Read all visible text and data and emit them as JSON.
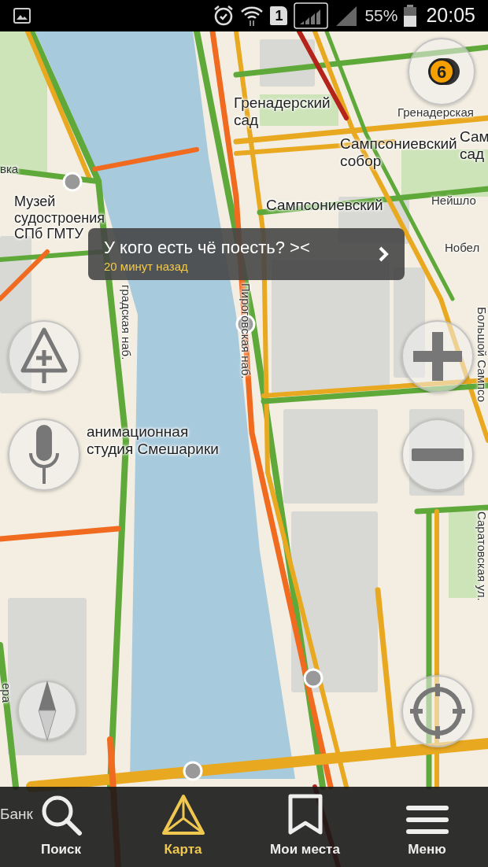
{
  "status_bar": {
    "sim": "1",
    "battery_text": "55%",
    "time": "20:05"
  },
  "map": {
    "labels": [
      {
        "text": "Гренадерский сад",
        "kind": "place"
      },
      {
        "text": "Гренадерская",
        "kind": "street"
      },
      {
        "text": "Сампсониевский собор",
        "kind": "place"
      },
      {
        "text": "Сам сад",
        "kind": "place"
      },
      {
        "text": "вка",
        "kind": "street"
      },
      {
        "text": "Музей судостроения СПб ГМТУ",
        "kind": "place"
      },
      {
        "text": "Сампсониевский",
        "kind": "place"
      },
      {
        "text": "Нейшло",
        "kind": "street"
      },
      {
        "text": "Нобел",
        "kind": "street"
      },
      {
        "text": "Пироговская наб.",
        "kind": "street_vertical"
      },
      {
        "text": "градская наб.",
        "kind": "street_vertical"
      },
      {
        "text": "Большой Сампсо",
        "kind": "street_vertical"
      },
      {
        "text": "анимационная студия Смешарики",
        "kind": "place"
      },
      {
        "text": "Саратовская ул.",
        "kind": "street_vertical"
      },
      {
        "text": "ера",
        "kind": "street_vertical"
      },
      {
        "text": "Банк",
        "kind": "place"
      }
    ],
    "event_bubble": {
      "message": "У кого есть чё поесть? ><",
      "time": "20 минут назад"
    },
    "traffic_score": "6"
  },
  "bottom_nav": [
    {
      "label": "Поиск",
      "kind": "search",
      "selected": false
    },
    {
      "label": "Карта",
      "kind": "map",
      "selected": true
    },
    {
      "label": "Мои места",
      "kind": "places",
      "selected": false
    },
    {
      "label": "Меню",
      "kind": "menu",
      "selected": false
    }
  ]
}
